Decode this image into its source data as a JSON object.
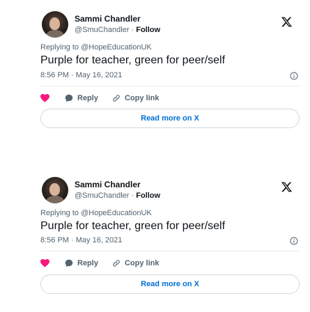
{
  "colors": {
    "text_primary": "#0f1419",
    "text_secondary": "#536471",
    "link_blue": "#006fd6",
    "heart_red": "#f91880",
    "border": "#cfd9de"
  },
  "tweets": [
    {
      "author_name": "Sammi Chandler",
      "author_handle": "@SmuChandler",
      "separator": " · ",
      "follow_label": "Follow",
      "replying_to": "Replying to @HopeEducationUK",
      "text": "Purple for teacher, green for peer/self",
      "timestamp": "8:56 PM · May 16, 2021",
      "reply_label": "Reply",
      "copy_link_label": "Copy link",
      "read_more_label": "Read more on X",
      "icons": {
        "logo": "x-logo-icon",
        "info": "info-icon",
        "like": "heart-icon",
        "reply": "reply-bubble-icon",
        "copy_link": "link-icon"
      }
    },
    {
      "author_name": "Sammi Chandler",
      "author_handle": "@SmuChandler",
      "separator": " · ",
      "follow_label": "Follow",
      "replying_to": "Replying to @HopeEducationUK",
      "text": "Purple for teacher, green for peer/self",
      "timestamp": "8:56 PM · May 16, 2021",
      "reply_label": "Reply",
      "copy_link_label": "Copy link",
      "read_more_label": "Read more on X",
      "icons": {
        "logo": "x-logo-icon",
        "info": "info-icon",
        "like": "heart-icon",
        "reply": "reply-bubble-icon",
        "copy_link": "link-icon"
      }
    }
  ]
}
